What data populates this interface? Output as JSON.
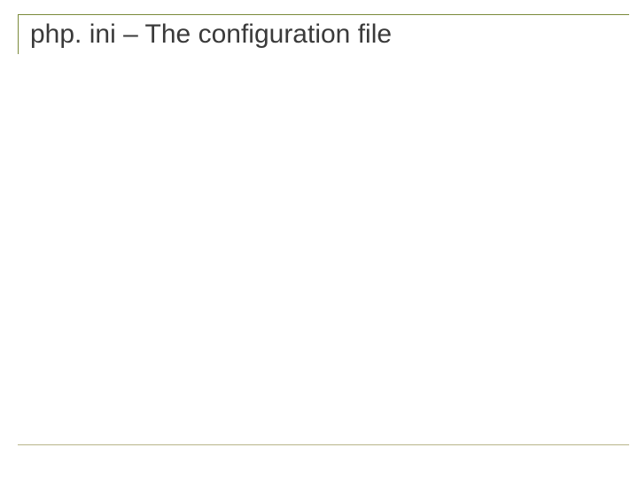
{
  "slide": {
    "title": "php. ini – The configuration file"
  }
}
